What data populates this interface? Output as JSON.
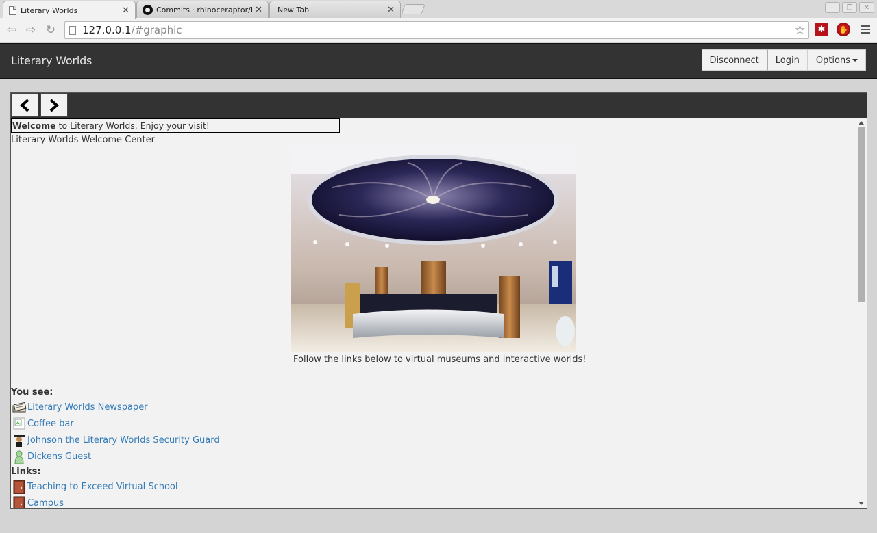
{
  "browser": {
    "tabs": [
      {
        "title": "Literary Worlds",
        "icon": "page-icon"
      },
      {
        "title": "Commits · rhinoceraptor/LitW",
        "icon": "github-icon"
      },
      {
        "title": "New Tab",
        "icon": "none"
      }
    ],
    "url_host": "127.0.0.1",
    "url_path": "/#graphic"
  },
  "navbar": {
    "brand": "Literary Worlds",
    "disconnect": "Disconnect",
    "login": "Login",
    "options": "Options"
  },
  "content": {
    "welcome_bold": "Welcome",
    "welcome_rest": " to Literary Worlds. Enjoy your visit!",
    "location_title": "Literary Worlds Welcome Center",
    "caption": "Follow the links below to virtual museums and interactive worlds!",
    "you_see_label": "You see:",
    "you_see": [
      {
        "label": "Literary Worlds Newspaper",
        "icon": "newspaper-icon"
      },
      {
        "label": "Coffee bar",
        "icon": "broken-image-icon"
      },
      {
        "label": "Johnson the Literary Worlds Security Guard",
        "icon": "guard-icon"
      },
      {
        "label": "Dickens Guest",
        "icon": "guest-icon"
      }
    ],
    "links_label": "Links:",
    "links": [
      {
        "label": "Teaching to Exceed Virtual School",
        "icon": "door-icon"
      },
      {
        "label": "Campus",
        "icon": "door-icon"
      }
    ]
  },
  "colors": {
    "navbar_bg": "#333333",
    "link": "#337ab7",
    "page_bg": "#f2f2f2"
  }
}
